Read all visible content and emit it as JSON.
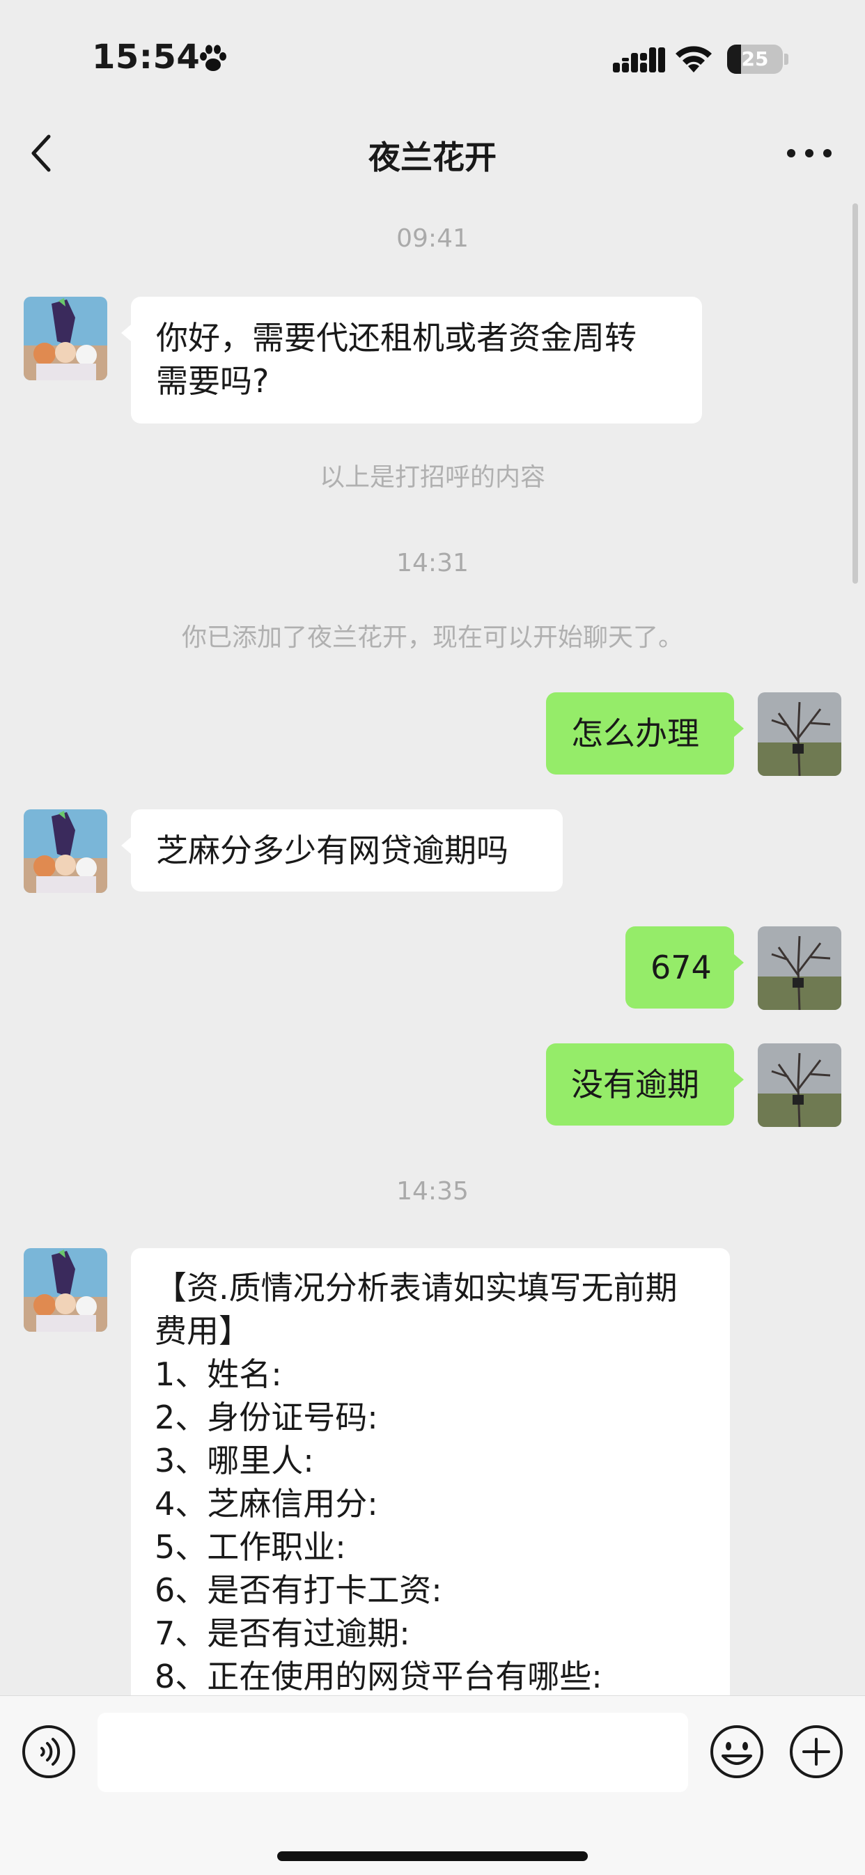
{
  "status_bar": {
    "time": "15:54",
    "battery_level": "25",
    "battery_fraction": 0.25,
    "icons": [
      "paw-icon",
      "cellular-signal-icon",
      "wifi-icon",
      "battery-icon"
    ]
  },
  "nav": {
    "title": "夜兰花开",
    "back_icon": "chevron-left-icon",
    "more_icon": "ellipsis-icon"
  },
  "chat": {
    "time_1": "09:41",
    "msg_1": [
      "你好，需要代还租机或者资金周转",
      "需要吗?"
    ],
    "sys_1": "以上是打招呼的内容",
    "time_2": "14:31",
    "sys_2": "你已添加了夜兰花开，现在可以开始聊天了。",
    "msg_2": "怎么办理",
    "msg_3": "芝麻分多少有网贷逾期吗",
    "msg_4": "674",
    "msg_5": "没有逾期",
    "time_3": "14:35",
    "msg_6": [
      "【资.质情况分析表请如实填写无前期",
      "费用】",
      "1、姓名:",
      "2、身份证号码:",
      "3、哪里人:",
      "4、芝麻信用分:",
      "5、工作职业:",
      "6、是否有打卡工资:",
      "7、是否有过逾期:",
      "8、正在使用的网贷平台有哪些:"
    ]
  },
  "input_bar": {
    "value": "",
    "icons": [
      "voice-icon",
      "emoji-icon",
      "plus-icon"
    ]
  },
  "colors": {
    "background": "#ededed",
    "outgoing_bubble": "#95ec69",
    "incoming_bubble": "#ffffff",
    "system_text": "#b0b0b0"
  }
}
